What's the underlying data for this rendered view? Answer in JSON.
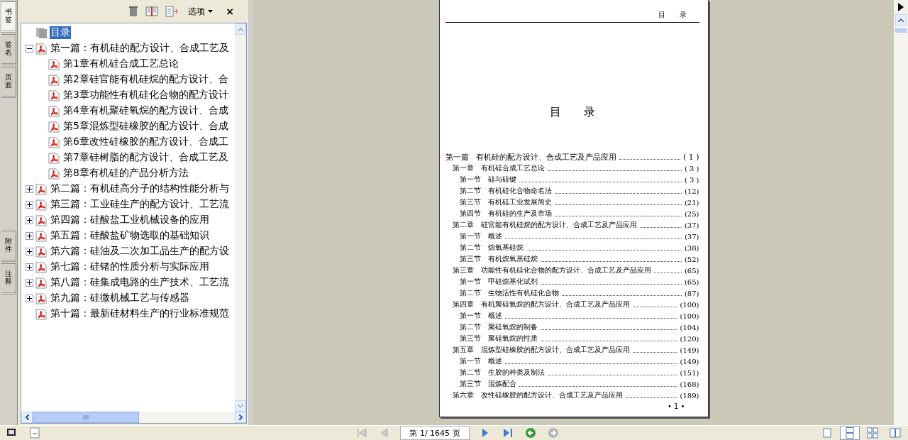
{
  "side_tabs": [
    {
      "label": "书签",
      "selected": true
    },
    {
      "label": "签名",
      "selected": false
    },
    {
      "label": "页面",
      "selected": false
    }
  ],
  "side_tabs_lower": [
    {
      "label": "附件",
      "selected": false
    },
    {
      "label": "注释",
      "selected": false
    }
  ],
  "panel": {
    "options_label": "选项",
    "close_label": "×"
  },
  "tree": {
    "root": {
      "label": "目录",
      "selected": true
    },
    "items": [
      {
        "label": "第一篇：有机硅的配方设计、合成工艺及",
        "kind": "branch",
        "expanded": true,
        "children": [
          {
            "label": "第1章有机硅合成工艺总论"
          },
          {
            "label": "第2章硅官能有机硅烷的配方设计、合"
          },
          {
            "label": "第3章功能性有机硅化合物的配方设计"
          },
          {
            "label": "第4章有机聚硅氧烷的配方设计、合成"
          },
          {
            "label": "第5章混炼型硅橡胶的配方设计、合成"
          },
          {
            "label": "第6章改性硅橡胶的配方设计、合成工"
          },
          {
            "label": "第7章硅树脂的配方设计、合成工艺及"
          },
          {
            "label": "第8章有机硅的产品分析方法"
          }
        ]
      },
      {
        "label": "第二篇：有机硅高分子的结构性能分析与",
        "kind": "branch",
        "expanded": false
      },
      {
        "label": "第三篇：工业硅生产的配方设计、工艺流",
        "kind": "branch",
        "expanded": false
      },
      {
        "label": "第四篇：硅酸盐工业机械设备的应用",
        "kind": "branch",
        "expanded": false
      },
      {
        "label": "第五篇：硅酸盐矿物选取的基础知识",
        "kind": "branch",
        "expanded": false
      },
      {
        "label": "第六篇：硅油及二次加工品生产的配方设",
        "kind": "branch",
        "expanded": false
      },
      {
        "label": "第七篇：硅锗的性质分析与实际应用",
        "kind": "branch",
        "expanded": false
      },
      {
        "label": "第八篇：硅集成电路的生产技术、工艺流",
        "kind": "branch",
        "expanded": false
      },
      {
        "label": "第九篇：硅微机械工艺与传感器",
        "kind": "branch",
        "expanded": false
      },
      {
        "label": "第十篇：最新硅材料生产的行业标准规范",
        "kind": "leaf"
      }
    ]
  },
  "page": {
    "header": "目　　录",
    "title": "目　　录",
    "footer": "• 1 •",
    "toc": [
      {
        "kind": "part",
        "number": "第一篇",
        "title": "有机硅的配方设计、合成工艺及产品应用",
        "page": "( 1 )"
      },
      {
        "kind": "chapter",
        "number": "第一章",
        "title": "有机硅合成工艺总论",
        "page": "( 3 )"
      },
      {
        "kind": "section",
        "number": "第一节",
        "title": "硅与硅键",
        "page": "( 3 )"
      },
      {
        "kind": "section",
        "number": "第二节",
        "title": "有机硅化合物命名法",
        "page": "(12)"
      },
      {
        "kind": "section",
        "number": "第三节",
        "title": "有机硅工业发展简史",
        "page": "(21)"
      },
      {
        "kind": "section",
        "number": "第四节",
        "title": "有机硅的生产及市场",
        "page": "(25)"
      },
      {
        "kind": "chapter",
        "number": "第二章",
        "title": "硅官能有机硅烷的配方设计、合成工艺及产品应用",
        "page": "(37)"
      },
      {
        "kind": "section",
        "number": "第一节",
        "title": "概述",
        "page": "(37)"
      },
      {
        "kind": "section",
        "number": "第二节",
        "title": "烷氧基硅烷",
        "page": "(38)"
      },
      {
        "kind": "section",
        "number": "第三节",
        "title": "有机烷氧基硅烷",
        "page": "(52)"
      },
      {
        "kind": "chapter",
        "number": "第三章",
        "title": "功能性有机硅化合物的配方设计、合成工艺及产品应用",
        "page": "(65)"
      },
      {
        "kind": "section",
        "number": "第一节",
        "title": "甲硅烷基化试剂",
        "page": "(65)"
      },
      {
        "kind": "section",
        "number": "第二节",
        "title": "生物活性有机硅化合物",
        "page": "(87)"
      },
      {
        "kind": "chapter",
        "number": "第四章",
        "title": "有机聚硅氧烷的配方设计、合成工艺及产品应用",
        "page": "(100)"
      },
      {
        "kind": "section",
        "number": "第一节",
        "title": "概述",
        "page": "(100)"
      },
      {
        "kind": "section",
        "number": "第二节",
        "title": "聚硅氧烷的制备",
        "page": "(104)"
      },
      {
        "kind": "section",
        "number": "第三节",
        "title": "聚硅氧烷的性质",
        "page": "(120)"
      },
      {
        "kind": "chapter",
        "number": "第五章",
        "title": "混炼型硅橡胶的配方设计、合成工艺及产品应用",
        "page": "(149)"
      },
      {
        "kind": "section",
        "number": "第一节",
        "title": "概述",
        "page": "(149)"
      },
      {
        "kind": "section",
        "number": "第二节",
        "title": "生胶的种类及制法",
        "page": "(151)"
      },
      {
        "kind": "section",
        "number": "第三节",
        "title": "混炼配合",
        "page": "(168)"
      },
      {
        "kind": "chapter",
        "number": "第六章",
        "title": "改性硅橡胶的配方设计、合成工艺及产品应用",
        "page": "(189)"
      }
    ]
  },
  "navigation": {
    "page_field": "第 1/ 1645 页",
    "back_enabled": true,
    "forward_enabled": false
  },
  "views": [
    {
      "kind": "single",
      "selected": false
    },
    {
      "kind": "continuous",
      "selected": true
    },
    {
      "kind": "grid",
      "selected": false
    },
    {
      "kind": "facing",
      "selected": false
    }
  ]
}
